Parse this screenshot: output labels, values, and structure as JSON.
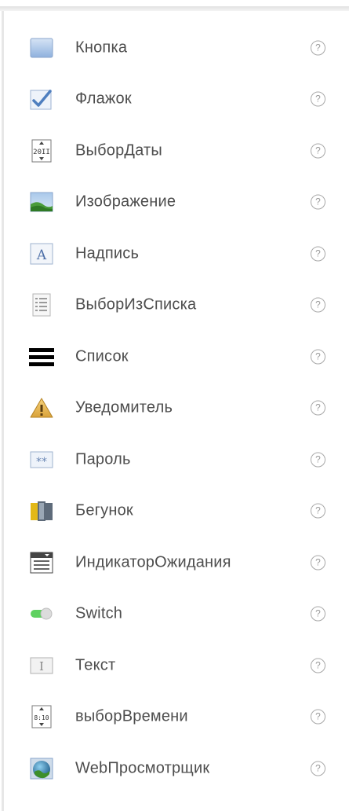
{
  "palette": {
    "items": [
      {
        "label": "Кнопка",
        "icon": "button-icon",
        "help": "?"
      },
      {
        "label": "Флажок",
        "icon": "checkbox-icon",
        "help": "?"
      },
      {
        "label": "ВыборДаты",
        "icon": "date-picker-icon",
        "help": "?",
        "icon_text": "20II"
      },
      {
        "label": "Изображение",
        "icon": "image-icon",
        "help": "?"
      },
      {
        "label": "Надпись",
        "icon": "label-icon",
        "help": "?",
        "icon_text": "A"
      },
      {
        "label": "ВыборИзСписка",
        "icon": "list-picker-icon",
        "help": "?"
      },
      {
        "label": "Список",
        "icon": "list-view-icon",
        "help": "?"
      },
      {
        "label": "Уведомитель",
        "icon": "notifier-icon",
        "help": "?"
      },
      {
        "label": "Пароль",
        "icon": "password-icon",
        "help": "?",
        "icon_text": "**"
      },
      {
        "label": "Бегунок",
        "icon": "slider-icon",
        "help": "?"
      },
      {
        "label": "ИндикаторОжидания",
        "icon": "spinner-icon",
        "help": "?"
      },
      {
        "label": "Switch",
        "icon": "switch-icon",
        "help": "?"
      },
      {
        "label": "Текст",
        "icon": "textbox-icon",
        "help": "?",
        "icon_text": "I"
      },
      {
        "label": "выборВремени",
        "icon": "time-picker-icon",
        "help": "?",
        "icon_text": "8:10"
      },
      {
        "label": "WebПросмотрщик",
        "icon": "web-viewer-icon",
        "help": "?"
      }
    ]
  }
}
